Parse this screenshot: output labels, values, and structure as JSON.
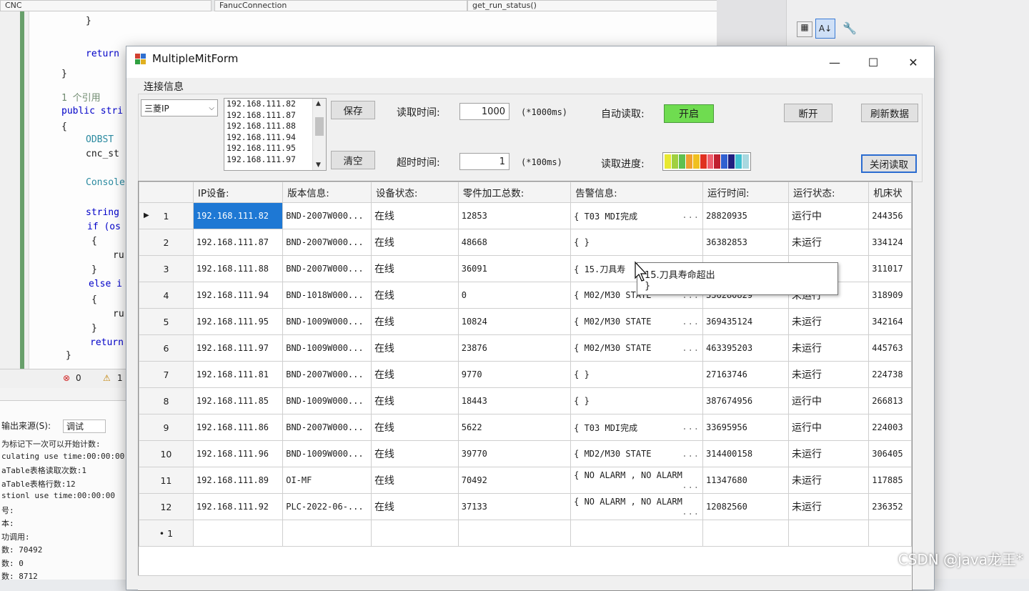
{
  "ide": {
    "dropdowns": [
      "CNC",
      "FanucConnection",
      "get_run_status()"
    ],
    "code_lines": [
      {
        "text": "}",
        "cls": ""
      },
      {
        "text": "return",
        "cls": "kw"
      },
      {
        "text": "}",
        "cls": ""
      },
      {
        "text": "1 个引用",
        "cls": "cm"
      },
      {
        "text": "public stri",
        "cls": "kw"
      },
      {
        "text": "{",
        "cls": ""
      },
      {
        "text": "ODBST",
        "cls": "ty"
      },
      {
        "text": "cnc_st",
        "cls": ""
      },
      {
        "text": "Console",
        "cls": "ty"
      },
      {
        "text": "string",
        "cls": "kw"
      },
      {
        "text": "if (os",
        "cls": "kw"
      },
      {
        "text": "{",
        "cls": ""
      },
      {
        "text": "ru",
        "cls": ""
      },
      {
        "text": "}",
        "cls": ""
      },
      {
        "text": "else i",
        "cls": "kw"
      },
      {
        "text": "{",
        "cls": ""
      },
      {
        "text": "ru",
        "cls": ""
      },
      {
        "text": "}",
        "cls": ""
      },
      {
        "text": "return",
        "cls": "kw"
      },
      {
        "text": "}",
        "cls": ""
      }
    ],
    "errors": "0",
    "warnings": "1",
    "output_source_label": "输出来源(S):",
    "output_source_value": "调试",
    "output_lines": [
      "为标记下一次可以开始计数:",
      "culating use time:00:00:00",
      "aTable表格读取次数:1",
      "aTable表格行数:12",
      "stionl use time:00:00:00",
      "号:",
      "本:",
      "功调用:",
      "数: 70492",
      "数: 0",
      "数: 8712"
    ]
  },
  "window": {
    "title": "MultipleMitForm",
    "minimize": "—",
    "maximize": "☐",
    "close": "✕"
  },
  "connection": {
    "legend": "连接信息",
    "combo_value": "三菱IP",
    "ip_list": [
      "192.168.111.82",
      "192.168.111.87",
      "192.168.111.88",
      "192.168.111.94",
      "192.168.111.95",
      "192.168.111.97"
    ],
    "save_label": "保存",
    "clear_label": "清空",
    "read_time_label": "读取时间:",
    "read_time_value": "1000",
    "read_time_unit": "(*1000ms)",
    "timeout_label": "超时时间:",
    "timeout_value": "1",
    "timeout_unit": "(*100ms)",
    "auto_read_label": "自动读取:",
    "auto_read_value": "开启",
    "progress_label": "读取进度:",
    "progress_colors": [
      "#e8e830",
      "#a0d040",
      "#60c050",
      "#f0a030",
      "#f0c020",
      "#e03020",
      "#f06070",
      "#c02030",
      "#3060d0",
      "#202080",
      "#40c0d0",
      "#a8d8e0"
    ],
    "disconnect_label": "断开",
    "refresh_label": "刷新数据",
    "close_read_label": "关闭读取"
  },
  "grid": {
    "headers": [
      "",
      "IP设备:",
      "版本信息:",
      "设备状态:",
      "零件加工总数:",
      "告警信息:",
      "运行时间:",
      "运行状态:",
      "机床状"
    ],
    "rows": [
      [
        "1",
        "192.168.111.82",
        "BND-2007W000...",
        "在线",
        "12853",
        "{ T03 MDI完成",
        "28820935",
        "运行中",
        "244356"
      ],
      [
        "2",
        "192.168.111.87",
        "BND-2007W000...",
        "在线",
        "48668",
        "{ }",
        "36382853",
        "未运行",
        "334124"
      ],
      [
        "3",
        "192.168.111.88",
        "BND-2007W000...",
        "在线",
        "36091",
        "{ 15.刀具寿",
        "",
        "",
        "311017"
      ],
      [
        "4",
        "192.168.111.94",
        "BND-1018W000...",
        "在线",
        "0",
        "{ M02/M30 STATE",
        "336280829",
        "未运行",
        "318909"
      ],
      [
        "5",
        "192.168.111.95",
        "BND-1009W000...",
        "在线",
        "10824",
        "{ M02/M30 STATE",
        "369435124",
        "未运行",
        "342164"
      ],
      [
        "6",
        "192.168.111.97",
        "BND-1009W000...",
        "在线",
        "23876",
        "{ M02/M30 STATE",
        "463395203",
        "未运行",
        "445763"
      ],
      [
        "7",
        "192.168.111.81",
        "BND-2007W000...",
        "在线",
        "9770",
        "{ }",
        "27163746",
        "未运行",
        "224738"
      ],
      [
        "8",
        "192.168.111.85",
        "BND-1009W000...",
        "在线",
        "18443",
        "{ }",
        "387674956",
        "运行中",
        "266813"
      ],
      [
        "9",
        "192.168.111.86",
        "BND-2007W000...",
        "在线",
        "5622",
        "{ T03 MDI完成",
        "33695956",
        "运行中",
        "224003"
      ],
      [
        "10",
        "192.168.111.96",
        "BND-1009W000...",
        "在线",
        "39770",
        "{ MD2/M30 STATE",
        "314400158",
        "未运行",
        "306405"
      ],
      [
        "11",
        "192.168.111.89",
        "OI-MF",
        "在线",
        "70492",
        "{ NO ALARM , NO ALARM",
        "11347680",
        "未运行",
        "117885"
      ],
      [
        "12",
        "192.168.111.92",
        "PLC-2022-06-...",
        "在线",
        "37133",
        "{ NO ALARM , NO ALARM",
        "12082560",
        "未运行",
        "236352"
      ]
    ],
    "new_row_marker": "1",
    "tooltip_line1": "15.刀具寿命超出",
    "tooltip_line2": "}"
  },
  "watermark": "CSDN @java龙王*"
}
